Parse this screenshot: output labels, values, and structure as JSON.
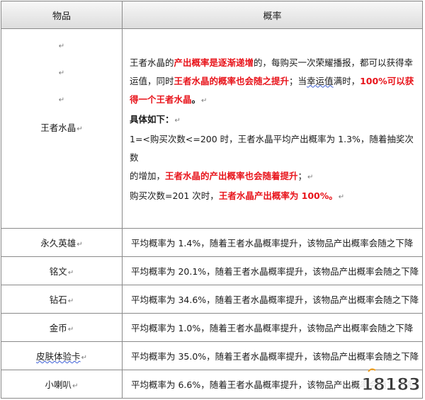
{
  "header": {
    "item_col": "物品",
    "prob_col": "概率"
  },
  "main_item": {
    "name": "王者水晶",
    "marks": [
      "↵",
      "↵",
      "↵"
    ],
    "line1": [
      {
        "t": "王者水晶的",
        "s": ""
      },
      {
        "t": "产出概率是逐渐递增",
        "s": "red"
      },
      {
        "t": "的，每购买一次荣耀播报，都可以获得幸",
        "s": ""
      }
    ],
    "line2": [
      {
        "t": "运值，同时",
        "s": ""
      },
      {
        "t": "王者水晶的概率也会随之提升",
        "s": "red"
      },
      {
        "t": "；当",
        "s": ""
      },
      {
        "t": "幸运值",
        "s": "sub"
      },
      {
        "t": "满时，",
        "s": ""
      },
      {
        "t": "100%可以获",
        "s": "red"
      }
    ],
    "line3": [
      {
        "t": "得一个王者水晶",
        "s": "red"
      },
      {
        "t": "。",
        "s": "bold"
      },
      {
        "t": "↵",
        "s": "pil"
      }
    ],
    "line4": [
      {
        "t": "具体如下：",
        "s": "bold"
      },
      {
        "t": "↵",
        "s": "pil"
      }
    ],
    "line5": [
      {
        "t": "1=<购买次数<=200 时，王者水晶平均产出概率为 1.3%，随着抽奖次数",
        "s": ""
      }
    ],
    "line6": [
      {
        "t": "的增加，",
        "s": ""
      },
      {
        "t": "王者水晶的产出概率也会随着提升",
        "s": "red"
      },
      {
        "t": "；",
        "s": ""
      },
      {
        "t": "↵",
        "s": "pil"
      }
    ],
    "line7": [
      {
        "t": "购买次数=201 次时，",
        "s": ""
      },
      {
        "t": "王者水晶产出概率为 100%。",
        "s": "red"
      },
      {
        "t": "↵",
        "s": "pil"
      }
    ]
  },
  "rows": [
    {
      "item": "永久英雄",
      "mark": "↵",
      "desc": "平均概率为 1.4%，随着王者水晶概率提升，该物品产出概率会随之下降"
    },
    {
      "item": "铭文",
      "mark": "↵",
      "desc": "平均概率为 20.1%，随着王者水晶概率提升，该物品产出概率会随之下降"
    },
    {
      "item": "钻石",
      "mark": "↵",
      "desc": "平均概率为 34.6%，随着王者水晶概率提升，该物品产出概率会随之下降"
    },
    {
      "item": "金币",
      "mark": "↵",
      "desc": "平均概率为 1.0%，随着王者水晶概率提升，该物品产出概率会随之下降"
    },
    {
      "item": "皮肤体验卡",
      "mark": "↵",
      "desc": "平均概率为 35.0%，随着王者水晶概率提升，该物品产出概率会随之下降"
    },
    {
      "item": "小喇叭",
      "mark": "↵",
      "desc": "平均概率为 6.6%，随着王者水晶概率提升，该物品产出概率会随之下降"
    }
  ],
  "watermark": {
    "text": "18183",
    "colors": {
      "main": "#3a3a3a",
      "accent": "#f0a020"
    }
  }
}
